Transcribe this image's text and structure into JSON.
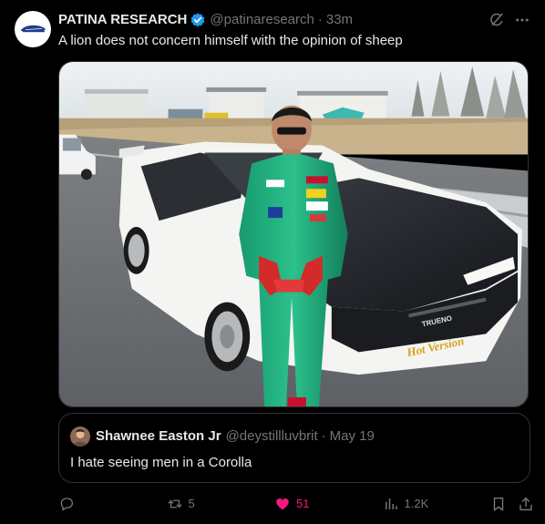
{
  "post": {
    "author_name": "PATINA RESEARCH",
    "author_handle": "@patinaresearch",
    "separator": "·",
    "time": "33m",
    "text": "A lion does not concern himself with the opinion of sheep",
    "verified": true
  },
  "media": {
    "car_plate_text": "TRUENO",
    "car_sticker_text": "Hot Version"
  },
  "quote": {
    "author_name": "Shawnee Easton Jr",
    "author_handle": "@deystillluvbrit",
    "separator": "·",
    "date": "May 19",
    "text": "I hate seeing men in a Corolla"
  },
  "actions": {
    "reply_count": "",
    "repost_count": "5",
    "like_count": "51",
    "views_count": "1.2K",
    "liked": true
  },
  "colors": {
    "background": "#000000",
    "text_primary": "#e7e9ea",
    "text_secondary": "#71767b",
    "border": "#2f3336",
    "like_pink": "#f91880",
    "verified_blue": "#1d9bf0"
  },
  "icons": {
    "avatar": "patina-logo",
    "verified": "verified-badge-icon",
    "grok": "grok-icon",
    "more": "more-icon",
    "reply": "reply-icon",
    "repost": "repost-icon",
    "like": "heart-icon",
    "views": "views-icon",
    "bookmark": "bookmark-icon",
    "share": "share-icon"
  }
}
